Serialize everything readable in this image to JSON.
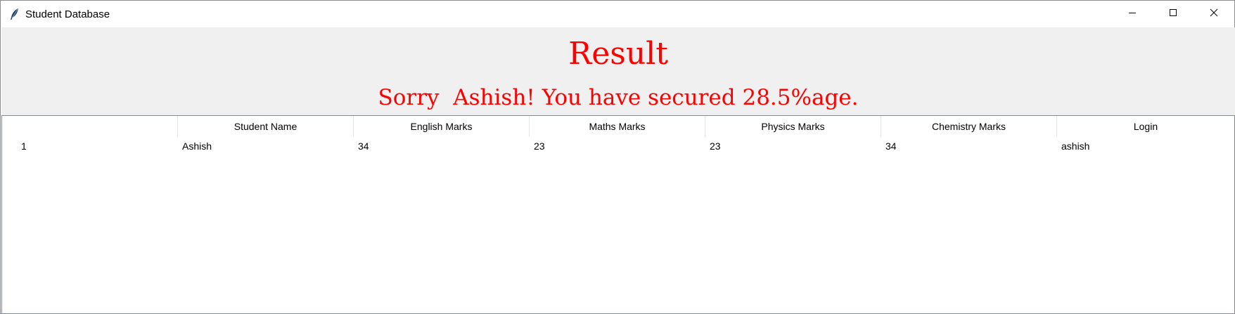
{
  "window": {
    "title": "Student Database"
  },
  "header": {
    "title": "Result",
    "message": "Sorry  Ashish! You have secured 28.5%age."
  },
  "table": {
    "columns": [
      "",
      "Student Name",
      "English Marks",
      "Maths Marks",
      "Physics Marks",
      "Chemistry Marks",
      "Login"
    ],
    "rows": [
      [
        "1",
        "Ashish",
        "34",
        "23",
        "23",
        "34",
        "ashish"
      ]
    ]
  },
  "colors": {
    "accent": "#ff0000",
    "header_bg": "#f0f0f0"
  },
  "icons": {
    "app": "feather-icon",
    "minimize": "minimize-icon",
    "maximize": "maximize-icon",
    "close": "close-icon"
  }
}
